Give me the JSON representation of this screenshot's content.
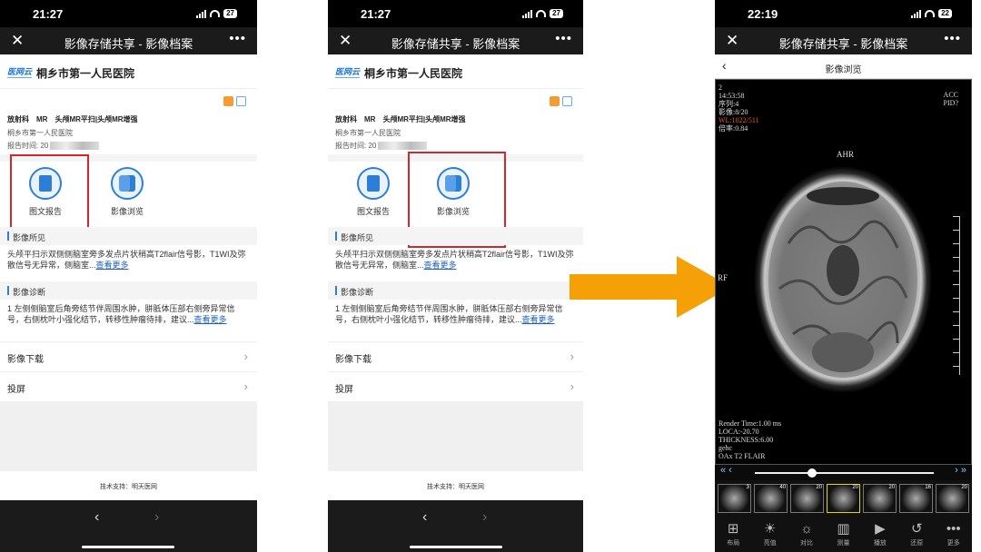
{
  "shared": {
    "time_left": "21:27",
    "time_right": "22:19",
    "battery_left": "27",
    "battery_right": "22",
    "nav_title": "影像存储共享 - 影像档案",
    "close_glyph": "✕",
    "more_glyph": "•••",
    "hospital_logo": "医网云",
    "hospital": "桐乡市第一人民医院",
    "exam": "放射科　MR　头颅MR平扫|头颅MR增强",
    "hospital_sub": "桐乡市第一人民医院",
    "report_time_label": "报告时间: 20",
    "btn_report": "图文报告",
    "btn_browse": "影像浏览",
    "findings_head": "影像所见",
    "findings_text": "头颅平扫示双侧侧脑室旁多发点片状稍高T2flair信号影，T1WI及弥散信号无异常，侧脑室...",
    "findings_more": "查看更多",
    "diag_head": "影像诊断",
    "diag_text": "1 左侧侧脑室后角旁结节伴周围水肿，胼胝体压部右侧旁异常信号，右侧枕叶小强化结节，转移性肿瘤待排，建议...",
    "diag_more": "查看更多",
    "row_download": "影像下载",
    "row_cast": "投屏",
    "chevron": "›",
    "footer": "技术支持：明天医网",
    "back": "‹",
    "fwd": "›"
  },
  "viewer": {
    "title": "影像浏览",
    "back": "‹",
    "ov_top": [
      "2",
      "14:53:58",
      "序列:4",
      "影像:8/20"
    ],
    "ov_wl": "WL:1022/511",
    "ov_zoom": "倍率:0.84",
    "ov_tr": [
      "ACC",
      "PID?"
    ],
    "ov_ahr": "AHR",
    "ov_rf": "RF",
    "ov_bottom": [
      "Render Time:1.00 ms",
      "LOCA:-20.70",
      "THICKNESS:6.00",
      "gehc",
      "OAx T2 FLAIR"
    ],
    "slider_left": "«  ‹",
    "slider_right": "›  »",
    "slider_position": 0.32,
    "thumbs": [
      {
        "n": "3"
      },
      {
        "n": "40"
      },
      {
        "n": "20"
      },
      {
        "n": "20"
      },
      {
        "n": "20"
      },
      {
        "n": "16"
      },
      {
        "n": "20"
      }
    ],
    "tools": [
      {
        "icon": "⊞",
        "label": "布局"
      },
      {
        "icon": "☀",
        "label": "亮值"
      },
      {
        "icon": "☼",
        "label": "对比"
      },
      {
        "icon": "▥",
        "label": "测量"
      },
      {
        "icon": "▶",
        "label": "播放"
      },
      {
        "icon": "↺",
        "label": "还原"
      },
      {
        "icon": "•••",
        "label": "更多"
      }
    ]
  },
  "colors": {
    "accent": "#2c7fd8",
    "highlight": "#d6262c",
    "arrow": "#f5a007"
  }
}
